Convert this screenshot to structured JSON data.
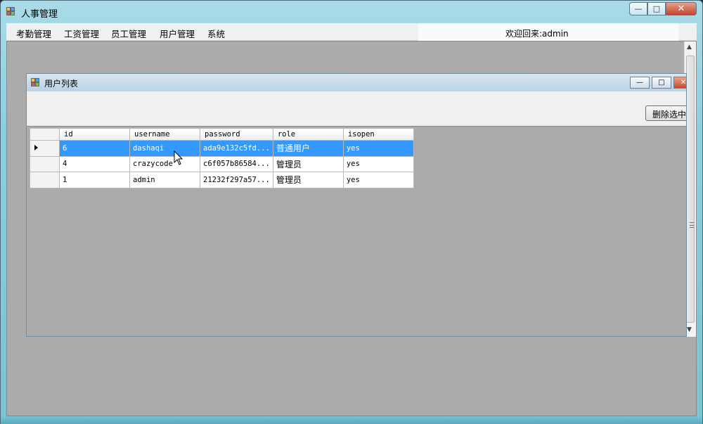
{
  "window": {
    "title": "人事管理",
    "controls": {
      "minimize": "—",
      "maximize": "□",
      "close": "✕"
    }
  },
  "menu": {
    "items": [
      "考勤管理",
      "工资管理",
      "员工管理",
      "用户管理",
      "系统"
    ],
    "welcome": "欢迎回来:admin"
  },
  "child_window": {
    "title": "用户列表",
    "delete_button": "删除选中"
  },
  "grid": {
    "columns": [
      "id",
      "username",
      "password",
      "role",
      "isopen"
    ],
    "rows": [
      {
        "id": "6",
        "username": "dashaqi",
        "password": "ada9e132c5fd...",
        "role": "普通用户",
        "isopen": "yes",
        "selected": true
      },
      {
        "id": "4",
        "username": "crazycode",
        "password": "c6f057b86584...",
        "role": "管理员",
        "isopen": "yes",
        "selected": false
      },
      {
        "id": "1",
        "username": "admin",
        "password": "21232f297a57...",
        "role": "管理员",
        "isopen": "yes",
        "selected": false
      }
    ]
  },
  "colors": {
    "selection": "#3399ff",
    "mdi_background": "#ababab",
    "titlebar": "#8ecfdd"
  }
}
